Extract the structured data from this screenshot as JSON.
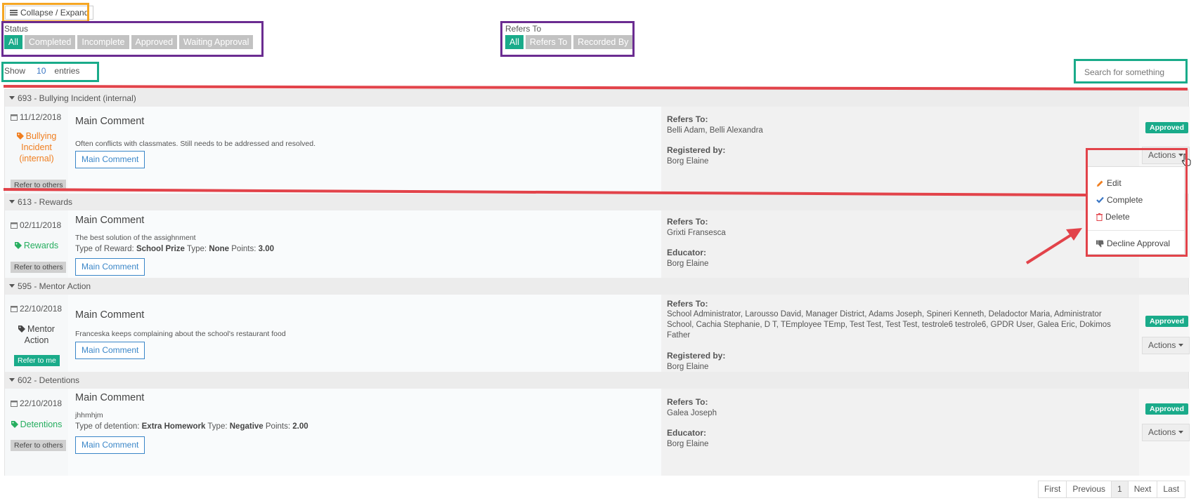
{
  "toolbar": {
    "collapse_label": "Collapse / Expand"
  },
  "status_filter": {
    "label": "Status",
    "options": [
      "All",
      "Completed",
      "Incomplete",
      "Approved",
      "Waiting Approval"
    ],
    "active": "All"
  },
  "refers_filter": {
    "label": "Refers To",
    "options": [
      "All",
      "Refers To",
      "Recorded By"
    ],
    "active": "All"
  },
  "page_size": {
    "prefix": "Show",
    "value": "10",
    "suffix": "entries"
  },
  "search": {
    "placeholder": "Search for something"
  },
  "records": [
    {
      "header": "693 - Bullying Incident (internal)",
      "date": "11/12/2018",
      "category": "Bullying Incident (internal)",
      "category_lines": [
        "Bullying",
        "Incident",
        "(internal)"
      ],
      "refer_button": "Refer to others",
      "title": "Main Comment",
      "description": "Often conflicts with classmates. Still needs to be addressed and resolved.",
      "comment_button": "Main Comment",
      "refers_label": "Refers To:",
      "refers_value": "Belli Adam, Belli Alexandra",
      "by_label": "Registered by:",
      "by_value": "Borg Elaine",
      "status": "Approved",
      "actions": "Actions"
    },
    {
      "header": "613 - Rewards",
      "date": "02/11/2018",
      "category": "Rewards",
      "refer_button": "Refer to others",
      "title": "Main Comment",
      "description": "The best solution of the assighnment",
      "extra": {
        "type_of_label": "Type of Reward:",
        "type_of_value": "School Prize",
        "type_label": "Type:",
        "type_value": "None",
        "points_label": "Points:",
        "points_value": "3.00"
      },
      "comment_button": "Main Comment",
      "refers_label": "Refers To:",
      "refers_value": "Grixti Fransesca",
      "by_label": "Educator:",
      "by_value": "Borg Elaine",
      "actions": "Actions"
    },
    {
      "header": "595 - Mentor Action",
      "date": "22/10/2018",
      "category": "Mentor Action",
      "category_lines": [
        "Mentor",
        "Action"
      ],
      "refer_button": "Refer to me",
      "title": "Main Comment",
      "description": "Franceska keeps complaining about the school's restaurant food",
      "comment_button": "Main Comment",
      "refers_label": "Refers To:",
      "refers_value": "School Administrator, Larousso David, Manager District, Adams Joseph, Spineri Kenneth, Deladoctor Maria, Administrator School, Cachia Stephanie, D T, TEmployee TEmp, Test Test, Test Test, testrole6 testrole6, GPDR User, Galea Eric, Dokimos Father",
      "by_label": "Registered by:",
      "by_value": "Borg Elaine",
      "status": "Approved",
      "actions": "Actions"
    },
    {
      "header": "602 - Detentions",
      "date": "22/10/2018",
      "category": "Detentions",
      "refer_button": "Refer to others",
      "title": "Main Comment",
      "description": "jhhmhjm",
      "extra": {
        "type_of_label": "Type of detention:",
        "type_of_value": "Extra Homework",
        "type_label": "Type:",
        "type_value": "Negative",
        "points_label": "Points:",
        "points_value": "2.00"
      },
      "comment_button": "Main Comment",
      "refers_label": "Refers To:",
      "refers_value": "Galea Joseph",
      "by_label": "Educator:",
      "by_value": "Borg Elaine",
      "status": "Approved",
      "actions": "Actions"
    }
  ],
  "actions_menu": {
    "items": [
      "Edit",
      "Complete",
      "Delete",
      "Decline Approval"
    ],
    "hidden_label": "Actions"
  },
  "pagination": [
    "First",
    "Previous",
    "1",
    "Next",
    "Last"
  ],
  "colors": {
    "accent": "#1aab8a",
    "highlight_orange": "#f5a623",
    "highlight_purple": "#6b2c91",
    "highlight_teal": "#1aab8a",
    "highlight_red": "#e2434a",
    "link_blue": "#3a86c8",
    "tag_orange": "#f07e1f",
    "tag_green": "#27ae60"
  },
  "icons": {
    "collapse": "hamburger-icon",
    "date": "calendar-icon",
    "category": "tag-icon",
    "group_toggle": "caret-down-icon",
    "edit": "pencil-icon",
    "complete": "check-icon",
    "delete": "trash-icon",
    "decline": "thumbs-down-icon"
  }
}
